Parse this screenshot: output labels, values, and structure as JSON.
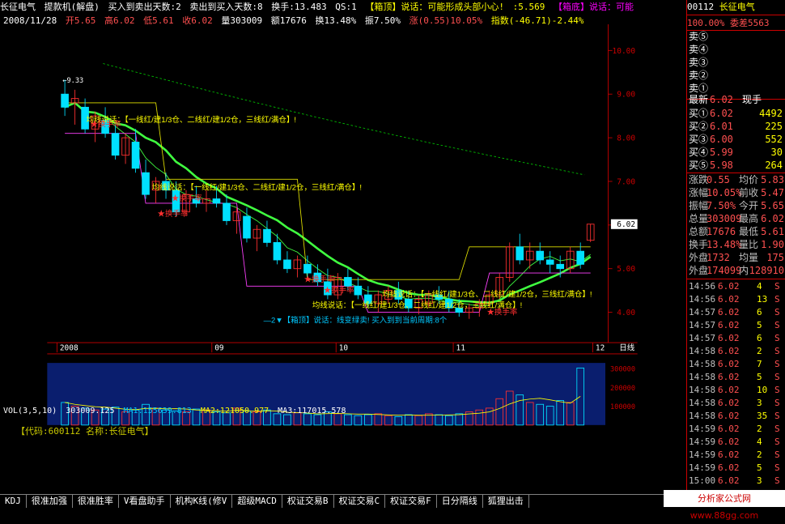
{
  "title_bar": {
    "stock_name": "长征电气",
    "indicator": "提款机(解盘)",
    "buy_to_sell": "买入到卖出天数:2",
    "sell_to_buy": "卖出到买入天数:8",
    "turnover": "换手:13.483",
    "qs": "QS:1",
    "top_signal": "【箱顶】说话：可能形成头部小心!",
    "value": ":5.569",
    "bottom_signal": "【箱底】说话：可能"
  },
  "ohlc_bar": {
    "date": "2008/11/28",
    "open": "开5.65",
    "high": "高6.02",
    "low": "低5.61",
    "close": "收6.02",
    "volume": "量303009",
    "amount": "额17676",
    "turnover": "换13.48%",
    "amplitude": "振7.50%",
    "change": "涨(0.55)10.05%",
    "index": "指数(-46.71)-2.44%"
  },
  "chart_data": {
    "type": "candlestick",
    "price_ticks": [
      "10.00",
      "9.00",
      "8.00",
      "7.00",
      "6.00",
      "5.00",
      "4.00"
    ],
    "high_label": "9.33",
    "current_price_tag": "6.02",
    "x_labels": [
      "2008",
      "09",
      "10",
      "11",
      "12"
    ],
    "date_label": "日线",
    "annotations": [
      "均线说话：【一线红/建1/3仓、二线红/建1/2仓，三线红/满仓】!",
      "★换手率",
      "—2▼【箱顶】说话：线变绿卖! 买入到到当前周期:8个"
    ],
    "candles": [
      {
        "o": 9.0,
        "h": 9.33,
        "l": 8.5,
        "c": 8.7
      },
      {
        "o": 8.8,
        "h": 9.1,
        "l": 8.3,
        "c": 8.9
      },
      {
        "o": 8.7,
        "h": 8.9,
        "l": 8.1,
        "c": 8.2
      },
      {
        "o": 8.2,
        "h": 8.6,
        "l": 7.9,
        "c": 8.5
      },
      {
        "o": 8.4,
        "h": 8.7,
        "l": 8.0,
        "c": 8.1
      },
      {
        "o": 8.1,
        "h": 8.3,
        "l": 7.5,
        "c": 7.6
      },
      {
        "o": 7.6,
        "h": 8.1,
        "l": 7.4,
        "c": 8.0
      },
      {
        "o": 7.9,
        "h": 8.2,
        "l": 7.2,
        "c": 7.3
      },
      {
        "o": 7.2,
        "h": 7.5,
        "l": 6.6,
        "c": 6.7
      },
      {
        "o": 6.8,
        "h": 7.1,
        "l": 6.5,
        "c": 7.0
      },
      {
        "o": 7.0,
        "h": 7.2,
        "l": 6.6,
        "c": 6.8
      },
      {
        "o": 6.8,
        "h": 7.0,
        "l": 6.2,
        "c": 6.3
      },
      {
        "o": 6.3,
        "h": 6.8,
        "l": 6.2,
        "c": 6.7
      },
      {
        "o": 6.6,
        "h": 6.9,
        "l": 6.4,
        "c": 6.5
      },
      {
        "o": 6.5,
        "h": 6.8,
        "l": 6.3,
        "c": 6.6
      },
      {
        "o": 6.6,
        "h": 6.9,
        "l": 6.4,
        "c": 6.5
      },
      {
        "o": 6.5,
        "h": 6.7,
        "l": 6.0,
        "c": 6.1
      },
      {
        "o": 6.1,
        "h": 6.4,
        "l": 5.8,
        "c": 6.3
      },
      {
        "o": 6.2,
        "h": 6.4,
        "l": 5.6,
        "c": 5.7
      },
      {
        "o": 5.7,
        "h": 6.0,
        "l": 5.4,
        "c": 5.9
      },
      {
        "o": 5.9,
        "h": 6.1,
        "l": 5.5,
        "c": 5.6
      },
      {
        "o": 5.6,
        "h": 5.8,
        "l": 5.1,
        "c": 5.2
      },
      {
        "o": 5.2,
        "h": 5.4,
        "l": 4.9,
        "c": 5.0
      },
      {
        "o": 5.0,
        "h": 5.3,
        "l": 4.8,
        "c": 5.2
      },
      {
        "o": 5.1,
        "h": 5.3,
        "l": 4.8,
        "c": 4.9
      },
      {
        "o": 4.9,
        "h": 5.1,
        "l": 4.6,
        "c": 4.7
      },
      {
        "o": 4.7,
        "h": 5.0,
        "l": 4.3,
        "c": 4.4
      },
      {
        "o": 4.4,
        "h": 4.9,
        "l": 4.3,
        "c": 4.8
      },
      {
        "o": 4.8,
        "h": 5.0,
        "l": 4.5,
        "c": 4.6
      },
      {
        "o": 4.6,
        "h": 4.8,
        "l": 4.3,
        "c": 4.4
      },
      {
        "o": 4.4,
        "h": 4.6,
        "l": 4.1,
        "c": 4.2
      },
      {
        "o": 4.2,
        "h": 4.5,
        "l": 4.0,
        "c": 4.4
      },
      {
        "o": 4.3,
        "h": 4.6,
        "l": 4.2,
        "c": 4.5
      },
      {
        "o": 4.5,
        "h": 4.7,
        "l": 4.2,
        "c": 4.3
      },
      {
        "o": 4.3,
        "h": 4.5,
        "l": 4.0,
        "c": 4.1
      },
      {
        "o": 4.1,
        "h": 4.4,
        "l": 3.95,
        "c": 4.3
      },
      {
        "o": 4.2,
        "h": 4.5,
        "l": 4.1,
        "c": 4.4
      },
      {
        "o": 4.4,
        "h": 4.6,
        "l": 4.2,
        "c": 4.3
      },
      {
        "o": 4.3,
        "h": 4.5,
        "l": 4.0,
        "c": 4.1
      },
      {
        "o": 4.1,
        "h": 4.3,
        "l": 3.9,
        "c": 4.0
      },
      {
        "o": 4.0,
        "h": 4.2,
        "l": 3.85,
        "c": 4.1
      },
      {
        "o": 4.1,
        "h": 4.3,
        "l": 3.9,
        "c": 4.2
      },
      {
        "o": 4.2,
        "h": 4.5,
        "l": 4.1,
        "c": 4.4
      },
      {
        "o": 4.4,
        "h": 4.9,
        "l": 4.3,
        "c": 4.8
      },
      {
        "o": 4.8,
        "h": 5.6,
        "l": 4.7,
        "c": 5.5
      },
      {
        "o": 5.5,
        "h": 5.8,
        "l": 5.1,
        "c": 5.2
      },
      {
        "o": 5.2,
        "h": 5.6,
        "l": 5.0,
        "c": 5.4
      },
      {
        "o": 5.4,
        "h": 5.6,
        "l": 5.1,
        "c": 5.2
      },
      {
        "o": 5.2,
        "h": 5.4,
        "l": 4.9,
        "c": 5.1
      },
      {
        "o": 5.1,
        "h": 5.3,
        "l": 4.8,
        "c": 5.0
      },
      {
        "o": 5.0,
        "h": 5.5,
        "l": 4.9,
        "c": 5.4
      },
      {
        "o": 5.4,
        "h": 5.6,
        "l": 5.0,
        "c": 5.1
      },
      {
        "o": 5.65,
        "h": 6.02,
        "l": 5.61,
        "c": 6.02
      }
    ],
    "volume_ticks": [
      "300000",
      "200000",
      "100000"
    ],
    "volumes": [
      120,
      100,
      90,
      80,
      85,
      95,
      70,
      80,
      110,
      90,
      80,
      75,
      70,
      85,
      80,
      70,
      65,
      90,
      75,
      70,
      80,
      60,
      55,
      65,
      60,
      55,
      70,
      60,
      55,
      50,
      55,
      60,
      50,
      45,
      55,
      50,
      60,
      55,
      50,
      60,
      70,
      80,
      90,
      140,
      180,
      160,
      120,
      110,
      100,
      130,
      120,
      303
    ]
  },
  "vol_bar": {
    "label": "VOL(3,5,10)",
    "vol": "303009.125",
    "ma1": "MA1:155639.813",
    "ma2": "MA2:121050.977",
    "ma3": "MA3:117015.578"
  },
  "stock_info": "【代码:600112 名称:长征电气】",
  "bottom_tabs": [
    "KDJ",
    "很准加强",
    "很准胜率",
    "V看盘助手",
    "机构K线(修V",
    "超级MACD",
    "权证交易B",
    "权证交易C",
    "权证交易F",
    "日分隔线",
    "狐狸出击"
  ],
  "site_badge": "分析家公式网www.88gg.com",
  "right_panel": {
    "code": "00112",
    "name": "长征电气",
    "committee_ratio": "100.00%",
    "committee_diff": "委差5563",
    "sell_rows": [
      {
        "label": "卖⑤",
        "price": "",
        "vol": ""
      },
      {
        "label": "卖④",
        "price": "",
        "vol": ""
      },
      {
        "label": "卖③",
        "price": "",
        "vol": ""
      },
      {
        "label": "卖②",
        "price": "",
        "vol": ""
      },
      {
        "label": "卖①",
        "price": "",
        "vol": ""
      }
    ],
    "latest_label": "最新",
    "latest_price": "6.02",
    "hand_label": "现手",
    "buy_rows": [
      {
        "label": "买①",
        "price": "6.02",
        "vol": "4492"
      },
      {
        "label": "买②",
        "price": "6.01",
        "vol": "225"
      },
      {
        "label": "买③",
        "price": "6.00",
        "vol": "552"
      },
      {
        "label": "买④",
        "price": "5.99",
        "vol": "30"
      },
      {
        "label": "买⑤",
        "price": "5.98",
        "vol": "264"
      }
    ],
    "stats": [
      {
        "l": "涨跌",
        "lv": "0.55",
        "r": "均价",
        "rv": "5.83"
      },
      {
        "l": "涨幅",
        "lv": "10.05%",
        "r": "前收",
        "rv": "5.47"
      },
      {
        "l": "振幅",
        "lv": "7.50%",
        "r": "今开",
        "rv": "5.65"
      },
      {
        "l": "总量",
        "lv": "303009",
        "r": "最高",
        "rv": "6.02"
      },
      {
        "l": "总额",
        "lv": "17676",
        "r": "最低",
        "rv": "5.61"
      },
      {
        "l": "换手",
        "lv": "13.48%",
        "r": "量比",
        "rv": "1.90"
      },
      {
        "l": "外盘",
        "lv": "1732",
        "r": "均量",
        "rv": "175"
      },
      {
        "l": "外盘",
        "lv": "174099",
        "r": "内",
        "rv": "128910"
      }
    ],
    "ticks": [
      {
        "t": "14:56",
        "p": "6.02",
        "v": "4",
        "s": "S"
      },
      {
        "t": "14:56",
        "p": "6.02",
        "v": "13",
        "s": "S"
      },
      {
        "t": "14:57",
        "p": "6.02",
        "v": "6",
        "s": "S"
      },
      {
        "t": "14:57",
        "p": "6.02",
        "v": "5",
        "s": "S"
      },
      {
        "t": "14:57",
        "p": "6.02",
        "v": "6",
        "s": "S"
      },
      {
        "t": "14:58",
        "p": "6.02",
        "v": "2",
        "s": "S"
      },
      {
        "t": "14:58",
        "p": "6.02",
        "v": "7",
        "s": "S"
      },
      {
        "t": "14:58",
        "p": "6.02",
        "v": "5",
        "s": "S"
      },
      {
        "t": "14:58",
        "p": "6.02",
        "v": "10",
        "s": "S"
      },
      {
        "t": "14:58",
        "p": "6.02",
        "v": "3",
        "s": "S"
      },
      {
        "t": "14:58",
        "p": "6.02",
        "v": "35",
        "s": "S"
      },
      {
        "t": "14:59",
        "p": "6.02",
        "v": "2",
        "s": "S"
      },
      {
        "t": "14:59",
        "p": "6.02",
        "v": "4",
        "s": "S"
      },
      {
        "t": "14:59",
        "p": "6.02",
        "v": "2",
        "s": "S"
      },
      {
        "t": "14:59",
        "p": "6.02",
        "v": "5",
        "s": "S"
      },
      {
        "t": "15:00",
        "p": "6.02",
        "v": "3",
        "s": "S"
      }
    ]
  }
}
